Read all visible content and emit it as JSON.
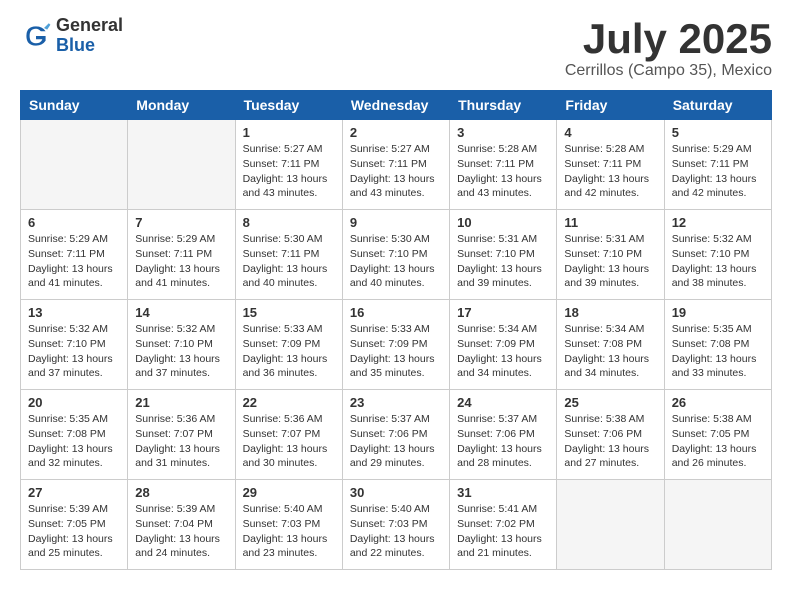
{
  "logo": {
    "general": "General",
    "blue": "Blue"
  },
  "title": "July 2025",
  "location": "Cerrillos (Campo 35), Mexico",
  "days_header": [
    "Sunday",
    "Monday",
    "Tuesday",
    "Wednesday",
    "Thursday",
    "Friday",
    "Saturday"
  ],
  "weeks": [
    [
      {
        "day": "",
        "info": ""
      },
      {
        "day": "",
        "info": ""
      },
      {
        "day": "1",
        "info": "Sunrise: 5:27 AM\nSunset: 7:11 PM\nDaylight: 13 hours and 43 minutes."
      },
      {
        "day": "2",
        "info": "Sunrise: 5:27 AM\nSunset: 7:11 PM\nDaylight: 13 hours and 43 minutes."
      },
      {
        "day": "3",
        "info": "Sunrise: 5:28 AM\nSunset: 7:11 PM\nDaylight: 13 hours and 43 minutes."
      },
      {
        "day": "4",
        "info": "Sunrise: 5:28 AM\nSunset: 7:11 PM\nDaylight: 13 hours and 42 minutes."
      },
      {
        "day": "5",
        "info": "Sunrise: 5:29 AM\nSunset: 7:11 PM\nDaylight: 13 hours and 42 minutes."
      }
    ],
    [
      {
        "day": "6",
        "info": "Sunrise: 5:29 AM\nSunset: 7:11 PM\nDaylight: 13 hours and 41 minutes."
      },
      {
        "day": "7",
        "info": "Sunrise: 5:29 AM\nSunset: 7:11 PM\nDaylight: 13 hours and 41 minutes."
      },
      {
        "day": "8",
        "info": "Sunrise: 5:30 AM\nSunset: 7:11 PM\nDaylight: 13 hours and 40 minutes."
      },
      {
        "day": "9",
        "info": "Sunrise: 5:30 AM\nSunset: 7:10 PM\nDaylight: 13 hours and 40 minutes."
      },
      {
        "day": "10",
        "info": "Sunrise: 5:31 AM\nSunset: 7:10 PM\nDaylight: 13 hours and 39 minutes."
      },
      {
        "day": "11",
        "info": "Sunrise: 5:31 AM\nSunset: 7:10 PM\nDaylight: 13 hours and 39 minutes."
      },
      {
        "day": "12",
        "info": "Sunrise: 5:32 AM\nSunset: 7:10 PM\nDaylight: 13 hours and 38 minutes."
      }
    ],
    [
      {
        "day": "13",
        "info": "Sunrise: 5:32 AM\nSunset: 7:10 PM\nDaylight: 13 hours and 37 minutes."
      },
      {
        "day": "14",
        "info": "Sunrise: 5:32 AM\nSunset: 7:10 PM\nDaylight: 13 hours and 37 minutes."
      },
      {
        "day": "15",
        "info": "Sunrise: 5:33 AM\nSunset: 7:09 PM\nDaylight: 13 hours and 36 minutes."
      },
      {
        "day": "16",
        "info": "Sunrise: 5:33 AM\nSunset: 7:09 PM\nDaylight: 13 hours and 35 minutes."
      },
      {
        "day": "17",
        "info": "Sunrise: 5:34 AM\nSunset: 7:09 PM\nDaylight: 13 hours and 34 minutes."
      },
      {
        "day": "18",
        "info": "Sunrise: 5:34 AM\nSunset: 7:08 PM\nDaylight: 13 hours and 34 minutes."
      },
      {
        "day": "19",
        "info": "Sunrise: 5:35 AM\nSunset: 7:08 PM\nDaylight: 13 hours and 33 minutes."
      }
    ],
    [
      {
        "day": "20",
        "info": "Sunrise: 5:35 AM\nSunset: 7:08 PM\nDaylight: 13 hours and 32 minutes."
      },
      {
        "day": "21",
        "info": "Sunrise: 5:36 AM\nSunset: 7:07 PM\nDaylight: 13 hours and 31 minutes."
      },
      {
        "day": "22",
        "info": "Sunrise: 5:36 AM\nSunset: 7:07 PM\nDaylight: 13 hours and 30 minutes."
      },
      {
        "day": "23",
        "info": "Sunrise: 5:37 AM\nSunset: 7:06 PM\nDaylight: 13 hours and 29 minutes."
      },
      {
        "day": "24",
        "info": "Sunrise: 5:37 AM\nSunset: 7:06 PM\nDaylight: 13 hours and 28 minutes."
      },
      {
        "day": "25",
        "info": "Sunrise: 5:38 AM\nSunset: 7:06 PM\nDaylight: 13 hours and 27 minutes."
      },
      {
        "day": "26",
        "info": "Sunrise: 5:38 AM\nSunset: 7:05 PM\nDaylight: 13 hours and 26 minutes."
      }
    ],
    [
      {
        "day": "27",
        "info": "Sunrise: 5:39 AM\nSunset: 7:05 PM\nDaylight: 13 hours and 25 minutes."
      },
      {
        "day": "28",
        "info": "Sunrise: 5:39 AM\nSunset: 7:04 PM\nDaylight: 13 hours and 24 minutes."
      },
      {
        "day": "29",
        "info": "Sunrise: 5:40 AM\nSunset: 7:03 PM\nDaylight: 13 hours and 23 minutes."
      },
      {
        "day": "30",
        "info": "Sunrise: 5:40 AM\nSunset: 7:03 PM\nDaylight: 13 hours and 22 minutes."
      },
      {
        "day": "31",
        "info": "Sunrise: 5:41 AM\nSunset: 7:02 PM\nDaylight: 13 hours and 21 minutes."
      },
      {
        "day": "",
        "info": ""
      },
      {
        "day": "",
        "info": ""
      }
    ]
  ]
}
